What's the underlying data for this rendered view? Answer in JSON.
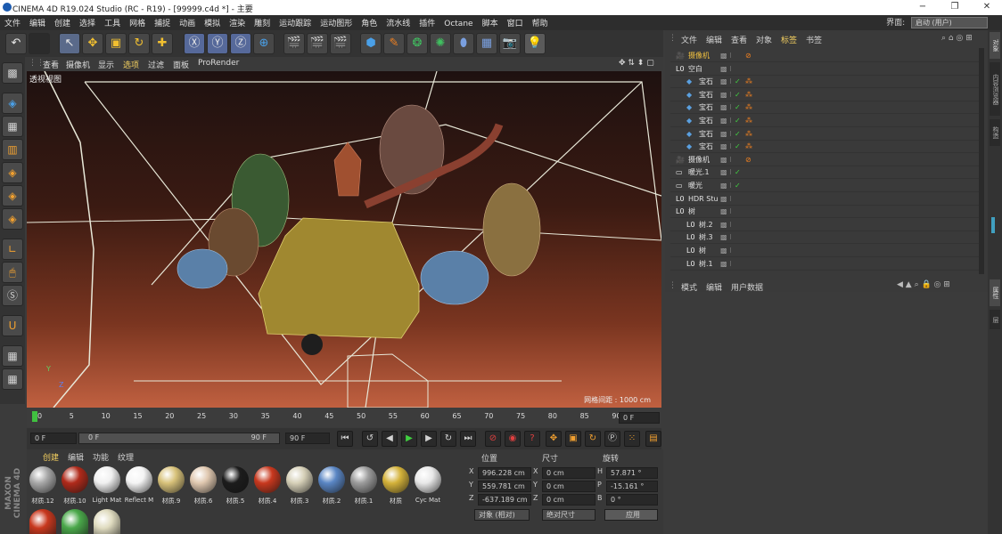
{
  "window": {
    "title": "CINEMA 4D R19.024 Studio (RC - R19) - [99999.c4d *] - 主要",
    "min": "−",
    "max": "❐",
    "close": "✕"
  },
  "menu": [
    "文件",
    "编辑",
    "创建",
    "选择",
    "工具",
    "网格",
    "捕捉",
    "动画",
    "模拟",
    "渲染",
    "雕刻",
    "运动跟踪",
    "运动图形",
    "角色",
    "流水线",
    "插件",
    "Octane",
    "脚本",
    "窗口",
    "帮助"
  ],
  "interface": {
    "label": "界面:",
    "value": "启动 (用户)"
  },
  "viewport": {
    "menu": [
      "查看",
      "摄像机",
      "显示",
      "选项",
      "过滤",
      "面板",
      "ProRender"
    ],
    "active_menu": "选项",
    "label": "透视视图",
    "grid": "网格间距 : 1000 cm",
    "axis_y": "Y",
    "axis_z": "Z"
  },
  "timeline": {
    "ticks": [
      "0",
      "5",
      "10",
      "15",
      "20",
      "25",
      "30",
      "35",
      "40",
      "45",
      "50",
      "55",
      "60",
      "65",
      "70",
      "75",
      "80",
      "85",
      "90"
    ],
    "frame": "0 F"
  },
  "timectrl": {
    "start": "0 F",
    "cur": "0 F",
    "end": "90 F",
    "range_end": "90 F"
  },
  "materials": {
    "menu": [
      "创建",
      "编辑",
      "功能",
      "纹理"
    ],
    "items": [
      {
        "label": "材质.12",
        "color": "#a8a8a8"
      },
      {
        "label": "材质.10",
        "color": "#b02a1a"
      },
      {
        "label": "Light Mat",
        "color": "#f0f0f0"
      },
      {
        "label": "Reflect M",
        "color": "#f4f4f4"
      },
      {
        "label": "材质.9",
        "color": "#d8c27a"
      },
      {
        "label": "材质.6",
        "color": "#e0c8b0"
      },
      {
        "label": "材质.5",
        "color": "#1c1c1c"
      },
      {
        "label": "材质.4",
        "color": "#c8381e"
      },
      {
        "label": "材质.3",
        "color": "#d6d0b8"
      },
      {
        "label": "材质.2",
        "color": "#5a86c4"
      },
      {
        "label": "材质.1",
        "color": "#9c9c9c"
      },
      {
        "label": "材质",
        "color": "#d4b23a"
      },
      {
        "label": "Cyc Mat",
        "color": "#e8e8e8"
      }
    ],
    "row2": [
      "#c8381e",
      "#4aa84a",
      "#e0dcc0"
    ]
  },
  "maxon": {
    "line1": "MAXON",
    "line2": "CINEMA 4D"
  },
  "coords": {
    "headers": [
      "位置",
      "尺寸",
      "旋转"
    ],
    "rows": [
      {
        "axis": "X",
        "pos": "996.228 cm",
        "size": "0 cm",
        "rot_label": "H",
        "rot": "57.871 °"
      },
      {
        "axis": "Y",
        "pos": "559.781 cm",
        "size": "0 cm",
        "rot_label": "P",
        "rot": "-15.161 °"
      },
      {
        "axis": "Z",
        "pos": "-637.189 cm",
        "size": "0 cm",
        "rot_label": "B",
        "rot": "0 °"
      }
    ],
    "mode": "对象 (相对)",
    "size_mode": "绝对尺寸",
    "apply": "应用"
  },
  "objmgr": {
    "menu": [
      "文件",
      "编辑",
      "查看",
      "对象",
      "标签",
      "书签"
    ],
    "rows": [
      {
        "name": "摄像机",
        "indent": 0,
        "color": "#f0c040",
        "tick": "",
        "icon": "cam"
      },
      {
        "name": "空白",
        "indent": 0,
        "color": "#e0e0e0",
        "tick": "",
        "icon": "null"
      },
      {
        "name": "宝石",
        "indent": 1,
        "color": "#e0e0e0",
        "tick": "✓",
        "icon": "gem"
      },
      {
        "name": "宝石",
        "indent": 1,
        "color": "#e0e0e0",
        "tick": "✓",
        "icon": "gem"
      },
      {
        "name": "宝石",
        "indent": 1,
        "color": "#e0e0e0",
        "tick": "✓",
        "icon": "gem"
      },
      {
        "name": "宝石",
        "indent": 1,
        "color": "#e0e0e0",
        "tick": "✓",
        "icon": "gem"
      },
      {
        "name": "宝石",
        "indent": 1,
        "color": "#e0e0e0",
        "tick": "✓",
        "icon": "gem"
      },
      {
        "name": "宝石",
        "indent": 1,
        "color": "#e0e0e0",
        "tick": "✓",
        "icon": "gem"
      },
      {
        "name": "摄像机",
        "indent": 0,
        "color": "#e0e0e0",
        "tick": "",
        "icon": "cam"
      },
      {
        "name": "暖光.1",
        "indent": 0,
        "color": "#e0e0e0",
        "tick": "✓",
        "icon": "light"
      },
      {
        "name": "暖光",
        "indent": 0,
        "color": "#e0e0e0",
        "tick": "✓",
        "icon": "light"
      },
      {
        "name": "HDR Stu",
        "indent": 0,
        "color": "#e0e0e0",
        "tick": "",
        "icon": "null"
      },
      {
        "name": "树",
        "indent": 0,
        "color": "#e0e0e0",
        "tick": "",
        "icon": "null"
      },
      {
        "name": "树.2",
        "indent": 1,
        "color": "#e0e0e0",
        "tick": "",
        "icon": "null"
      },
      {
        "name": "树.3",
        "indent": 1,
        "color": "#e0e0e0",
        "tick": "",
        "icon": "null"
      },
      {
        "name": "树",
        "indent": 1,
        "color": "#e0e0e0",
        "tick": "",
        "icon": "null"
      },
      {
        "name": "树.1",
        "indent": 1,
        "color": "#e0e0e0",
        "tick": "",
        "icon": "null"
      }
    ]
  },
  "attr": {
    "menu": [
      "模式",
      "编辑",
      "用户数据"
    ]
  },
  "sidetabs": [
    "对象",
    "内容浏览器",
    "构造",
    "属性",
    "层"
  ]
}
